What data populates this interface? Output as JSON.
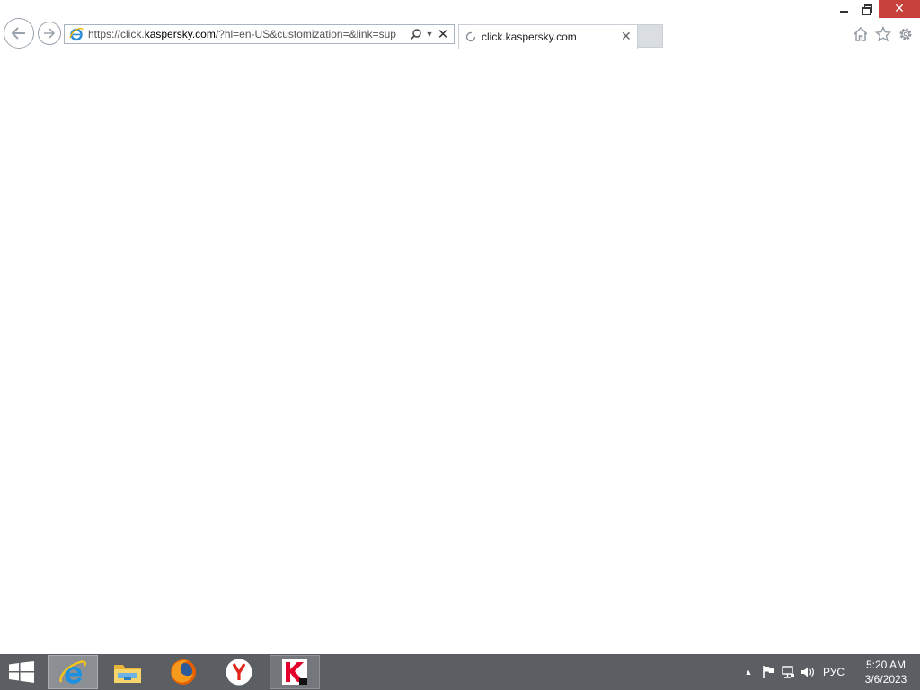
{
  "window": {
    "minimize_icon": "minimize-icon",
    "restore_icon": "restore-icon",
    "close_icon": "close-icon",
    "close_glyph": "✕",
    "close_color": "#c7403b"
  },
  "navbar": {
    "back_icon": "back-arrow-icon",
    "forward_icon": "forward-arrow-icon",
    "address": {
      "url_prefix": "https://click.",
      "url_domain": "kaspersky.com",
      "url_rest": "/?hl=en-US&customization=&link=sup",
      "stop_glyph": "✕",
      "dropdown_glyph": "▼"
    },
    "tab": {
      "title": "click.kaspersky.com",
      "close_glyph": "✕"
    },
    "tools": [
      "home-icon",
      "favorites-icon",
      "tools-icon"
    ]
  },
  "taskbar": {
    "apps": [
      {
        "name": "Internet Explorer",
        "state": "active"
      },
      {
        "name": "File Explorer",
        "state": "idle"
      },
      {
        "name": "Firefox",
        "state": "idle"
      },
      {
        "name": "Yandex Browser",
        "state": "idle"
      },
      {
        "name": "Kaspersky",
        "state": "running"
      }
    ],
    "tray": {
      "chevron_glyph": "▲",
      "language": "РУС",
      "time": "5:20 AM",
      "date": "3/6/2023"
    },
    "color": "#5b5f63"
  }
}
